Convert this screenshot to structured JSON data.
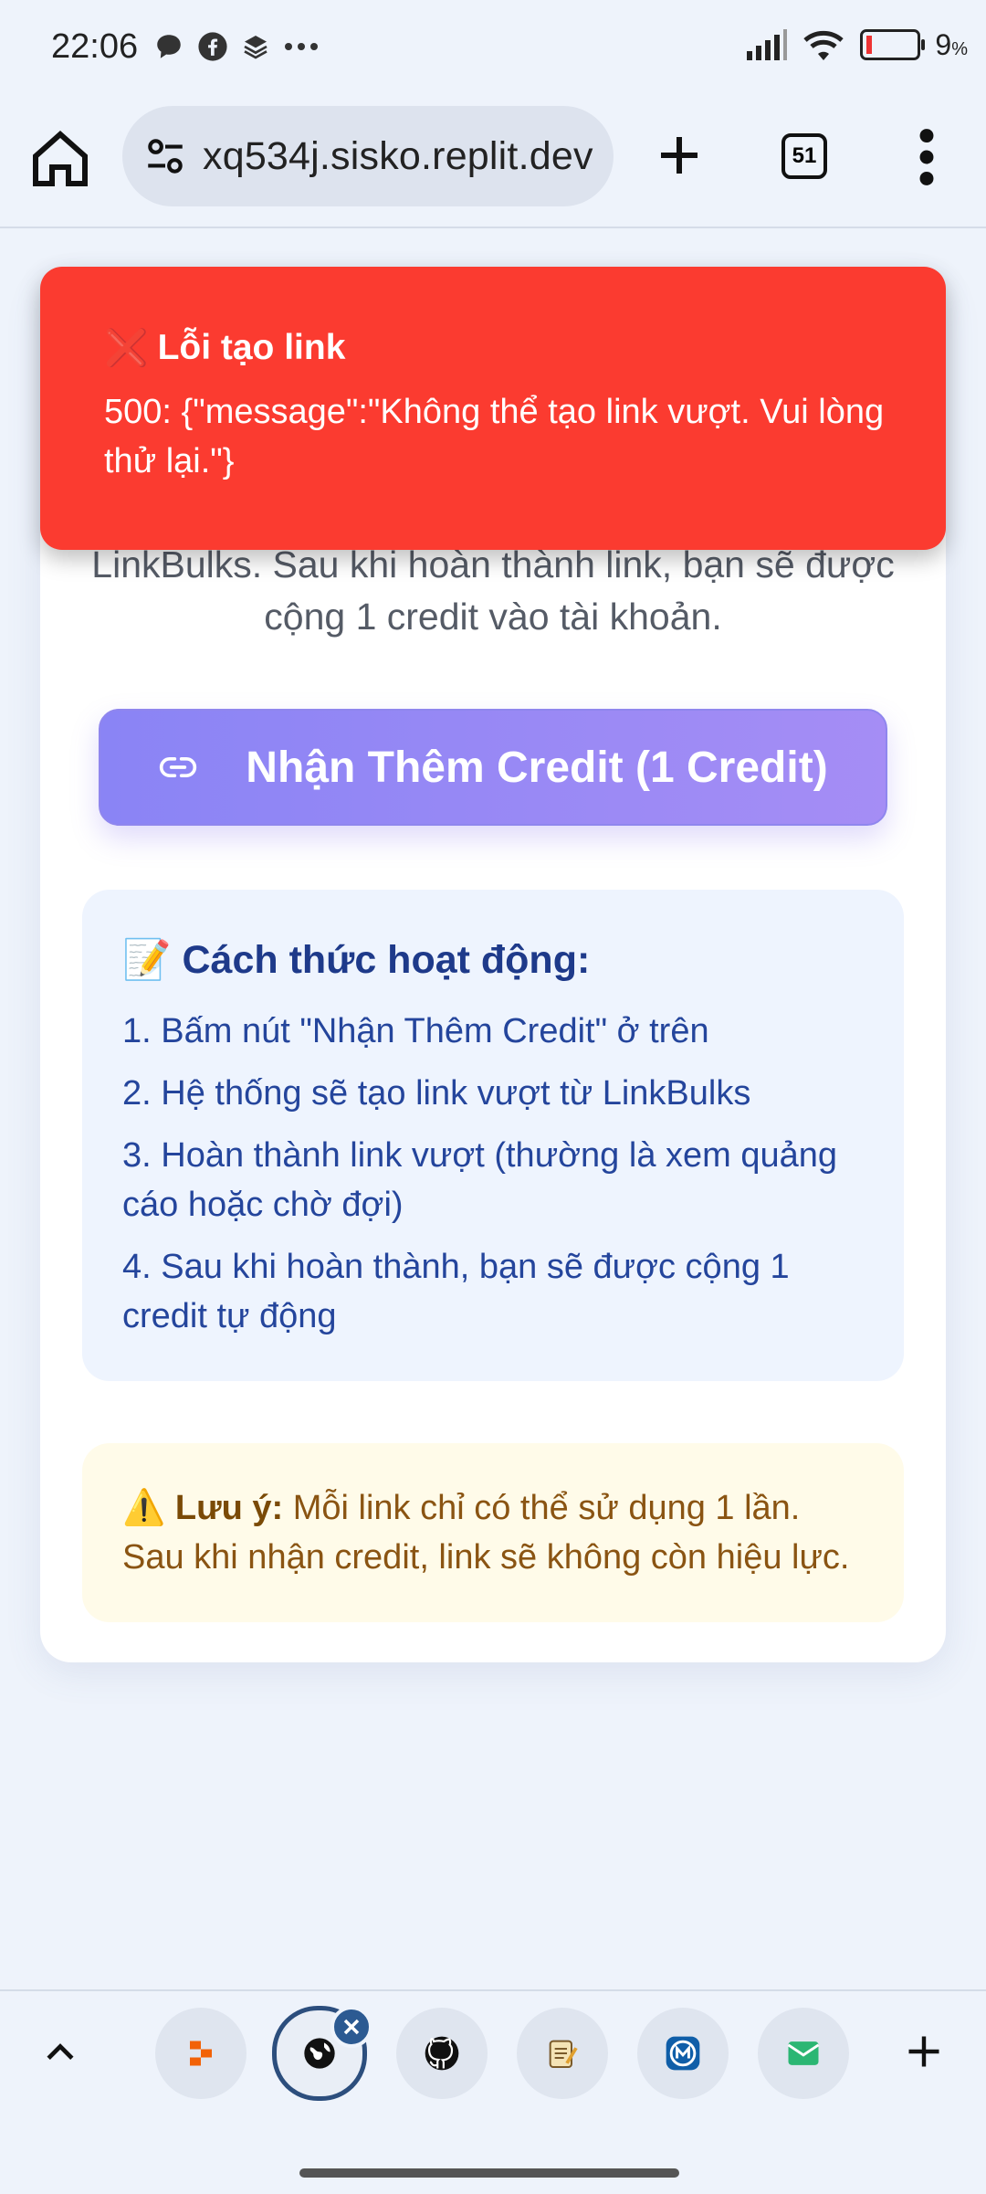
{
  "status_bar": {
    "time": "22:06",
    "battery_percent": "9",
    "battery_unit": "%",
    "notification_icons": [
      "chat-bubble-icon",
      "facebook-icon",
      "layers-icon",
      "more-dots-icon"
    ]
  },
  "browser": {
    "url": "xq534j.sisko.replit.dev",
    "tab_count": "51"
  },
  "page": {
    "intro_line1": "LinkBulks. Sau khi hoàn thành link, bạn sẽ được",
    "intro_line2": "cộng 1 credit vào tài khoản.",
    "cta_label": "Nhận Thêm Credit (1 Credit)",
    "howto_emoji": "📝",
    "howto_title": "Cách thức hoạt động:",
    "steps": [
      "1. Bấm nút \"Nhận Thêm Credit\" ở trên",
      "2. Hệ thống sẽ tạo link vượt từ LinkBulks",
      "3. Hoàn thành link vượt (thường là xem quảng cáo hoặc chờ đợi)",
      "4. Sau khi hoàn thành, bạn sẽ được cộng 1 credit tự động"
    ],
    "note_emoji": "⚠️",
    "note_label": "Lưu ý:",
    "note_text": " Mỗi link chỉ có thể sử dụng 1 lần. Sau khi nhận credit, link sẽ không còn hiệu lực."
  },
  "toast": {
    "icon": "❌",
    "title": "Lỗi tạo link",
    "message": "500: {\"message\":\"Không thể tạo link vượt. Vui lòng thử lại.\"}"
  },
  "bottom_bar": {
    "tabs": [
      "replit-tab-icon",
      "globe-tab-icon",
      "github-tab-icon",
      "notepad-tab-icon",
      "app-tab-icon",
      "mail-tab-icon"
    ]
  },
  "colors": {
    "toast_bg": "#fb3b30",
    "cta_gradient_start": "#8a84f5",
    "cta_gradient_end": "#a58df5",
    "howto_text": "#24459c",
    "note_bg": "#fffbe9"
  }
}
